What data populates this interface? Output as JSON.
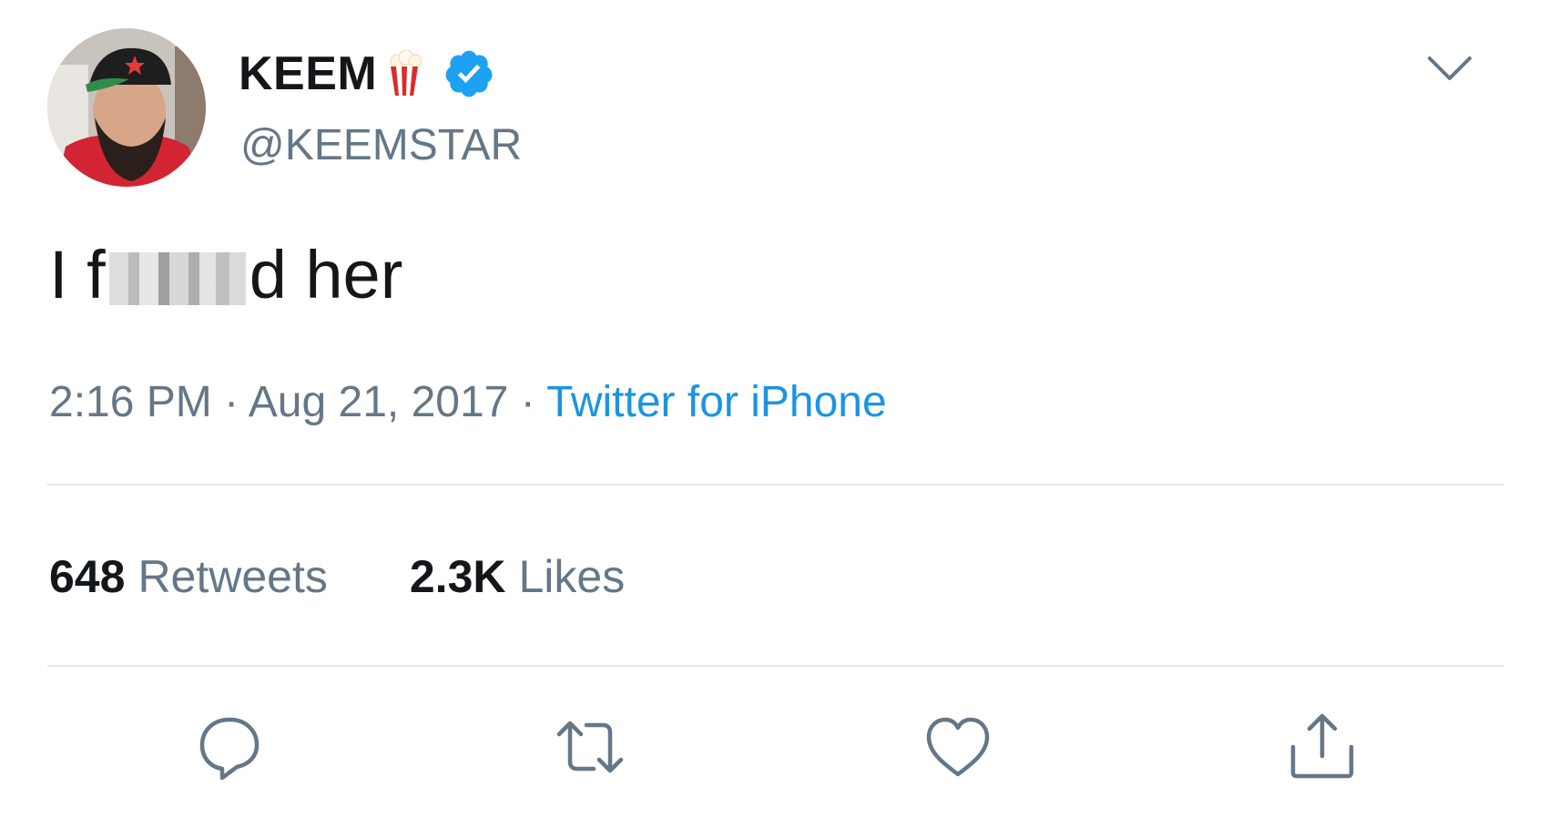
{
  "tweet": {
    "display_name": "KEEM",
    "handle": "@KEEMSTAR",
    "text_before": "I f",
    "text_after": "d her",
    "time": "2:16 PM",
    "separator": " · ",
    "date": "Aug 21, 2017",
    "source": "Twitter for iPhone"
  },
  "stats": {
    "retweets_count": "648",
    "retweets_label": "Retweets",
    "likes_count": "2.3K",
    "likes_label": "Likes"
  },
  "icons": {
    "avatar": "profile-photo",
    "name_emoji": "popcorn-icon",
    "badge": "verified-badge-icon",
    "menu": "chevron-down-icon",
    "reply": "reply-icon",
    "retweet": "retweet-icon",
    "like": "heart-icon",
    "share": "share-icon"
  },
  "colors": {
    "text": "#14171a",
    "secondary": "#657786",
    "link": "#1b95e0",
    "verified": "#1da1f2",
    "divider": "#e1e8ed"
  }
}
